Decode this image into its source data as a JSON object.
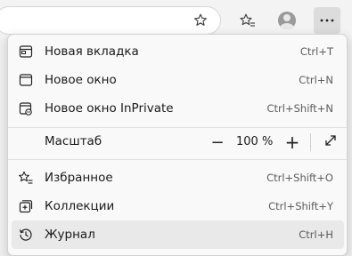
{
  "toolbar": {
    "favorite_icon": "star-add-icon",
    "favorites_icon": "favorites-star-icon",
    "profile_icon": "profile-avatar-icon",
    "more_icon": "more-dots-icon"
  },
  "menu": {
    "items_top": [
      {
        "label": "Новая вкладка",
        "shortcut": "Ctrl+T",
        "icon": "new-tab-icon"
      },
      {
        "label": "Новое окно",
        "shortcut": "Ctrl+N",
        "icon": "new-window-icon"
      },
      {
        "label": "Новое окно InPrivate",
        "shortcut": "Ctrl+Shift+N",
        "icon": "inprivate-window-icon"
      }
    ],
    "zoom": {
      "label": "Масштаб",
      "value": "100 %",
      "minus": "−",
      "plus": "+",
      "fullscreen_icon": "fullscreen-expand-icon"
    },
    "items_bottom": [
      {
        "label": "Избранное",
        "shortcut": "Ctrl+Shift+O",
        "icon": "favorites-icon"
      },
      {
        "label": "Коллекции",
        "shortcut": "Ctrl+Shift+Y",
        "icon": "collections-icon"
      },
      {
        "label": "Журнал",
        "shortcut": "Ctrl+H",
        "icon": "history-icon",
        "highlighted": true
      }
    ]
  },
  "colors": {
    "menu_bg": "#f9f9f9",
    "hover_bg": "#e9e9e9",
    "text": "#1a1a1a",
    "shortcut": "#5c5c5c"
  }
}
